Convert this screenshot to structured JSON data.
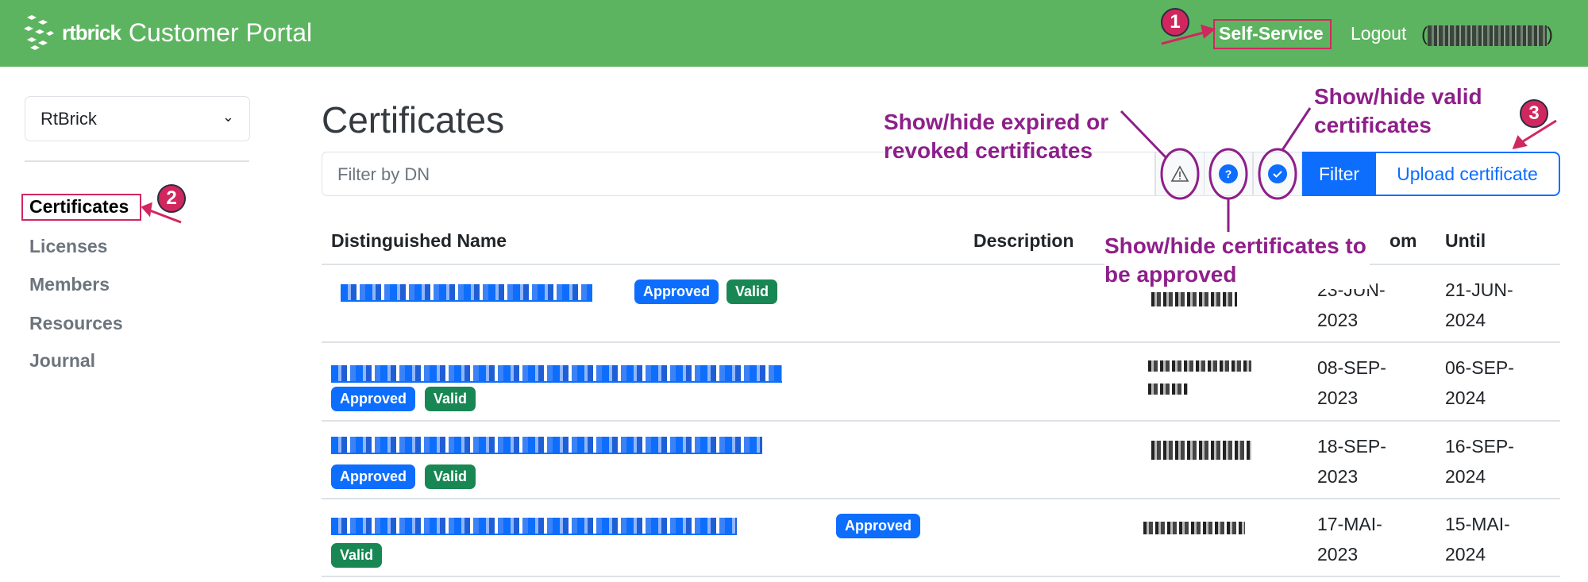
{
  "header": {
    "brand_word": "rtbrick",
    "title": "Customer Portal",
    "self_service": "Self-Service",
    "logout": "Logout",
    "colors": {
      "bar": "#5db460"
    }
  },
  "sidebar": {
    "org_select": "RtBrick",
    "items": [
      {
        "label": "Certificates",
        "active": true
      },
      {
        "label": "Licenses"
      },
      {
        "label": "Members"
      },
      {
        "label": "Resources"
      },
      {
        "label": "Journal"
      }
    ]
  },
  "main": {
    "title": "Certificates",
    "filter_placeholder": "Filter by DN",
    "toggles": [
      {
        "icon": "warning-triangle-icon"
      },
      {
        "icon": "question-badge-icon"
      },
      {
        "icon": "check-badge-icon"
      }
    ],
    "filter_button": "Filter",
    "upload_button": "Upload certificate",
    "columns": [
      "Distinguished Name",
      "Description",
      "om",
      "Until"
    ],
    "rows": [
      {
        "badges": [
          "Approved",
          "Valid"
        ],
        "from": [
          "23-JUN-",
          "2023"
        ],
        "until": [
          "21-JUN-",
          "2024"
        ]
      },
      {
        "badges": [
          "Approved",
          "Valid"
        ],
        "from": [
          "08-SEP-",
          "2023"
        ],
        "until": [
          "06-SEP-",
          "2024"
        ]
      },
      {
        "badges": [
          "Approved",
          "Valid"
        ],
        "from": [
          "18-SEP-",
          "2023"
        ],
        "until": [
          "16-SEP-",
          "2024"
        ]
      },
      {
        "badges": [
          "Approved",
          "Valid"
        ],
        "from": [
          "17-MAI-",
          "2023"
        ],
        "until": [
          "15-MAI-",
          "2024"
        ]
      }
    ]
  },
  "annotations": {
    "expired": [
      "Show/hide expired or",
      "revoked certificates"
    ],
    "valid": [
      "Show/hide valid",
      "certificates"
    ],
    "approve": [
      "Show/hide certificates to",
      "be approved"
    ],
    "numbers": [
      "1",
      "2",
      "3"
    ],
    "colors": {
      "text": "#8e1f8a",
      "marker": "#d0285e"
    }
  }
}
